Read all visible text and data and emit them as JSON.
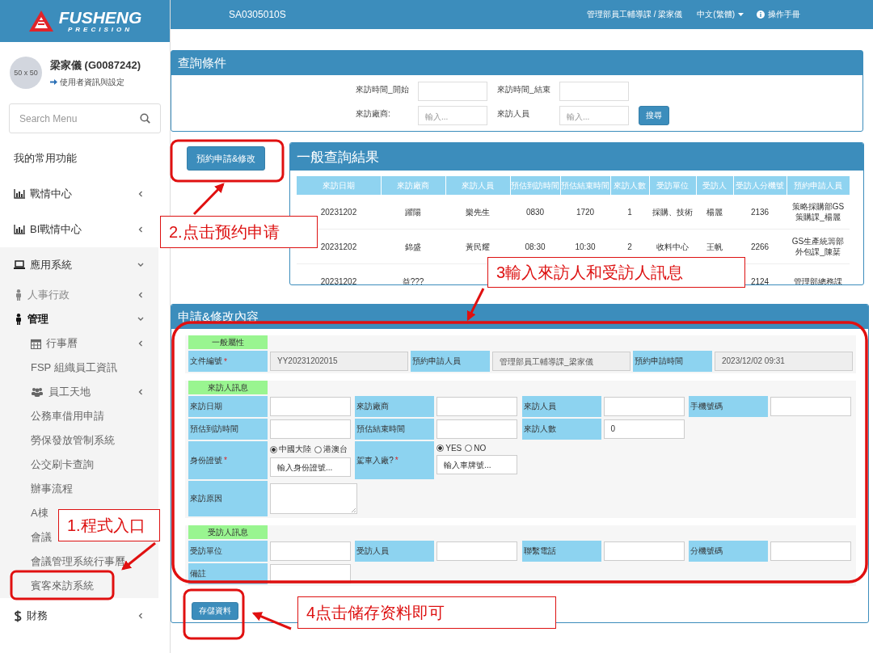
{
  "sidebar": {
    "logo": {
      "name": "FUSHENG",
      "tagline": "PRECISION"
    },
    "user": {
      "avatar_text": "50 x 50",
      "name": "梁家儀 (G0087242)",
      "settings_link": "使用者資訊與設定"
    },
    "search": {
      "placeholder": "Search Menu"
    },
    "items": [
      {
        "label": "我的常用功能",
        "kind": "plain"
      },
      {
        "label": "戰情中心",
        "kind": "chart",
        "expanded": false
      },
      {
        "label": "BI戰情中心",
        "kind": "chart",
        "expanded": false
      },
      {
        "label": "應用系統",
        "kind": "laptop",
        "expanded": true,
        "children": [
          {
            "label": "人事行政",
            "kind": "person",
            "expanded": false
          },
          {
            "label": "管理",
            "kind": "person",
            "expanded": true,
            "children": [
              {
                "label": "行事曆",
                "kind": "calendar",
                "expanded": false
              },
              {
                "label": "FSP 組織員工資訊",
                "kind": "plain"
              },
              {
                "label": "員工天地",
                "kind": "users",
                "expanded": false
              },
              {
                "label": "公務車借用申請",
                "kind": "plain"
              },
              {
                "label": "勞保發放管制系統",
                "kind": "plain"
              },
              {
                "label": "公交刷卡查詢",
                "kind": "plain"
              },
              {
                "label": "辦事流程",
                "kind": "plain"
              },
              {
                "label": "A棟",
                "kind": "plain"
              },
              {
                "label": "會議",
                "kind": "plain"
              },
              {
                "label": "會議管理系統行事曆",
                "kind": "plain"
              },
              {
                "label": "賓客來訪系統",
                "kind": "plain"
              }
            ]
          }
        ]
      },
      {
        "label": "財務",
        "kind": "dollar",
        "expanded": false
      }
    ]
  },
  "topbar": {
    "page_code": "SA0305010S",
    "user_dept": "管理部員工輔導課 / 梁家儀",
    "language": "中文(繁體)",
    "manual": "操作手冊"
  },
  "query": {
    "title": "查詢條件",
    "fields": [
      {
        "label": "來訪時間_開始"
      },
      {
        "label": "來訪時間_結束"
      },
      {
        "label": "來訪廠商:",
        "placeholder": "輸入..."
      },
      {
        "label": "來訪人員",
        "placeholder": "輸入..."
      }
    ],
    "search_button": "搜尋"
  },
  "new_button": "預約申請&修改",
  "results": {
    "title": "一般查詢結果",
    "columns": [
      "來訪日期",
      "來訪廠商",
      "來訪人員",
      "預估到訪時間",
      "預估結束時間",
      "來訪人數",
      "受訪單位",
      "受訪人",
      "受訪人分機號",
      "預約申請人員"
    ],
    "rows": [
      [
        "20231202",
        "躍陽",
        "樂先生",
        "0830",
        "1720",
        "1",
        "採購、技術",
        "楊麗",
        "2136",
        "策略採購部GS策購課_楊麗"
      ],
      [
        "20231202",
        "錦盛",
        "黃民耀",
        "08:30",
        "10:30",
        "2",
        "收料中心",
        "王帆",
        "2266",
        "GS生產統籌部外包課_陳棻"
      ],
      [
        "20231202",
        "益???",
        null,
        null,
        null,
        null,
        null,
        null,
        "2124",
        "管理部總務課"
      ]
    ]
  },
  "form": {
    "title": "申請&修改內容",
    "sections": [
      {
        "title": "一般屬性",
        "rows": [
          [
            {
              "label": "文件編號",
              "required_mark": "*",
              "kind": "readonly",
              "value": "YY20231202015"
            },
            {
              "label": "預約申請人員",
              "kind": "readonly",
              "value": "管理部員工輔導課_梁家儀"
            },
            {
              "label": "預約申請時間",
              "kind": "readonly",
              "value": "2023/12/02 09:31"
            }
          ]
        ]
      },
      {
        "title": "來訪人訊息",
        "rows": [
          [
            {
              "label": "來訪日期",
              "kind": "text"
            },
            {
              "label": "來訪廠商",
              "kind": "text"
            },
            {
              "label": "來訪人員",
              "kind": "text"
            },
            {
              "label": "手機號碼",
              "kind": "text"
            }
          ],
          [
            {
              "label": "預估到訪時間",
              "kind": "text"
            },
            {
              "label": "預估結束時間",
              "kind": "text"
            },
            {
              "label": "來訪人數",
              "kind": "text",
              "value": "0"
            }
          ],
          [
            {
              "label": "身份證號",
              "required_mark": "*",
              "kind": "radio_text",
              "options": [
                {
                  "label": "中國大陸",
                  "selected": true
                },
                {
                  "label": "港澳台",
                  "selected": false
                }
              ],
              "placeholder": "輸入身份證號..."
            },
            {
              "label": "駕車入廠?",
              "required_mark": "*",
              "kind": "radio_text",
              "options": [
                {
                  "label": "YES",
                  "selected": true
                },
                {
                  "label": "NO",
                  "selected": false
                }
              ],
              "placeholder": "輸入車牌號..."
            }
          ],
          [
            {
              "label": "來訪原因",
              "kind": "textarea"
            }
          ]
        ]
      },
      {
        "title": "受訪人訊息",
        "rows": [
          [
            {
              "label": "受訪單位",
              "kind": "text"
            },
            {
              "label": "受訪人員",
              "kind": "text"
            },
            {
              "label": "聯繫電話",
              "kind": "text"
            },
            {
              "label": "分機號碼",
              "kind": "text"
            }
          ],
          [
            {
              "label": "備註",
              "kind": "text"
            }
          ]
        ]
      }
    ],
    "save_button": "存儲資料"
  },
  "annotations": [
    {
      "text": "2.点击预约申请"
    },
    {
      "text": "3輸入來訪人和受訪人訊息"
    },
    {
      "text": "1.程式入口"
    },
    {
      "text": "4点击储存资料即可"
    }
  ]
}
